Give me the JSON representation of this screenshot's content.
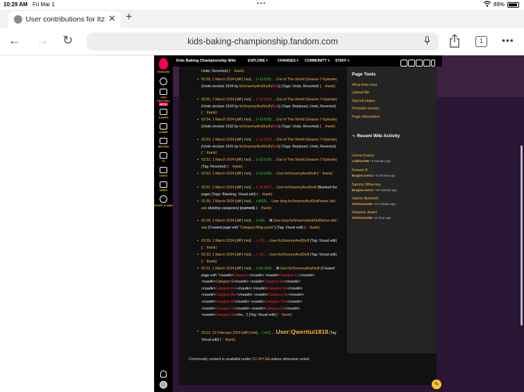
{
  "status_bar": {
    "time": "10:29 AM",
    "date": "Fri Mar 1",
    "battery": "89%"
  },
  "browser": {
    "tab_title": "User contributions for ItzSmarmyAndStuff",
    "url": "kids-baking-championship.fandom.com",
    "tab_count": "1"
  },
  "fandom_rail": {
    "logo_label": "FANDOM",
    "items": [
      {
        "label": "FAN CENTRAL",
        "badge": "BETA"
      },
      {
        "label": "GAMES"
      },
      {
        "label": "ANIME"
      },
      {
        "label": "MOVIES"
      },
      {
        "label": "TV"
      },
      {
        "label": "VIDEO"
      },
      {
        "label": "WIKIS"
      },
      {
        "label": "START A WIKI"
      }
    ]
  },
  "wiki_header": {
    "name": "Kids Baking Championship Wiki",
    "menus": [
      "EXPLORE",
      "CHANGES",
      "COMMUNITY",
      "STAFF"
    ]
  },
  "contributions": [
    {
      "lines": [
        [
          "Undo, Reverted) (",
          "w"
        ],
        [
          "♡",
          "heart"
        ],
        [
          " thank)",
          "y"
        ]
      ]
    },
    {
      "lines": [
        [
          "02:55, 1 March 2024",
          "y"
        ],
        [
          " (",
          "w"
        ],
        [
          "diff",
          "y"
        ],
        [
          " | ",
          "w"
        ],
        [
          "hist",
          "y"
        ],
        [
          ") . . ",
          "w"
        ],
        [
          "(+13,625)",
          "g"
        ],
        [
          " . . ",
          "w"
        ],
        [
          "Out of This World (Season 7 Episode)",
          "y"
        ],
        [
          " (Undo revision 3194 by ",
          "wi"
        ],
        [
          "ItzSmarmyAndStuff",
          "yi"
        ],
        [
          " (",
          "wi"
        ],
        [
          "talk",
          "ri"
        ],
        [
          ")) (Tags: Undo, Reverted) (",
          "w"
        ],
        [
          "♡",
          "heart"
        ],
        [
          " thank)",
          "y"
        ]
      ]
    },
    {
      "lines": [
        [
          "02:55, 1 March 2024",
          "y"
        ],
        [
          " (",
          "w"
        ],
        [
          "diff",
          "y"
        ],
        [
          " | ",
          "w"
        ],
        [
          "hist",
          "y"
        ],
        [
          ") . . ",
          "w"
        ],
        [
          "(−13,625)",
          "r"
        ],
        [
          " . . ",
          "w"
        ],
        [
          "Out of This World (Season 7 Episode)",
          "y"
        ],
        [
          " (Undo revision 3193 by ",
          "wi"
        ],
        [
          "ItzSmarmyAndStuff",
          "yi"
        ],
        [
          " (",
          "wi"
        ],
        [
          "talk",
          "ri"
        ],
        [
          ")) (Tags: Replaced, Undo, Reverted) (",
          "w"
        ],
        [
          "♡",
          "heart"
        ],
        [
          " thank)",
          "y"
        ]
      ]
    },
    {
      "lines": [
        [
          "02:54, 1 March 2024",
          "y"
        ],
        [
          " (",
          "w"
        ],
        [
          "diff",
          "y"
        ],
        [
          " | ",
          "w"
        ],
        [
          "hist",
          "y"
        ],
        [
          ") . . ",
          "w"
        ],
        [
          "(+13,625)",
          "g"
        ],
        [
          " . . ",
          "w"
        ],
        [
          "Out of This World (Season 7 Episode)",
          "y"
        ],
        [
          " (Undo revision 3192 by ",
          "wi"
        ],
        [
          "ItzSmarmyAndStuff",
          "yi"
        ],
        [
          " (",
          "wi"
        ],
        [
          "talk",
          "ri"
        ],
        [
          ")) (Tags: Undo, Reverted) (",
          "w"
        ],
        [
          "♡",
          "heart"
        ],
        [
          " thank)",
          "y"
        ]
      ]
    },
    {
      "lines": [
        [
          "02:53, 1 March 2024",
          "y"
        ],
        [
          " (",
          "w"
        ],
        [
          "diff",
          "y"
        ],
        [
          " | ",
          "w"
        ],
        [
          "hist",
          "y"
        ],
        [
          ") . . ",
          "w"
        ],
        [
          "(−13,625)",
          "r"
        ],
        [
          " . . ",
          "w"
        ],
        [
          "Out of This World (Season 7 Episode)",
          "y"
        ],
        [
          " (Undo revision 3191 by ",
          "wi"
        ],
        [
          "ItzSmarmyAndStuff",
          "yi"
        ],
        [
          " (",
          "wi"
        ],
        [
          "talk",
          "ri"
        ],
        [
          ")) (Tags: Replaced, Undo, Reverted) (",
          "w"
        ],
        [
          "♡",
          "heart"
        ],
        [
          " thank)",
          "y"
        ]
      ]
    },
    {
      "lines": [
        [
          "02:52, 1 March 2024",
          "y"
        ],
        [
          " (",
          "w"
        ],
        [
          "diff",
          "y"
        ],
        [
          " | ",
          "w"
        ],
        [
          "hist",
          "y"
        ],
        [
          ") . . ",
          "w"
        ],
        [
          "(+13,625)",
          "g"
        ],
        [
          " . . ",
          "w"
        ],
        [
          "Out of This World (Season 7 Episode)",
          "y"
        ],
        [
          " (Tag: Reverted) (",
          "w"
        ],
        [
          "♡",
          "heart"
        ],
        [
          " thank)",
          "y"
        ]
      ]
    },
    {
      "lines": [
        [
          "02:52, 1 March 2024",
          "y"
        ],
        [
          " (",
          "w"
        ],
        [
          "diff",
          "y"
        ],
        [
          " | ",
          "w"
        ],
        [
          "hist",
          "y"
        ],
        [
          ") . . ",
          "w"
        ],
        [
          "(+13,626)",
          "g"
        ],
        [
          " . . ",
          "w"
        ],
        [
          "User:ItzSmarmyAndStuff",
          "y"
        ],
        [
          " (",
          "w"
        ],
        [
          "♡",
          "heart"
        ],
        [
          " thank)",
          "y"
        ]
      ]
    },
    {
      "lines": [
        [
          "02:51, 1 March 2024",
          "y"
        ],
        [
          " (",
          "w"
        ],
        [
          "diff",
          "y"
        ],
        [
          " | ",
          "w"
        ],
        [
          "hist",
          "y"
        ],
        [
          ") . . ",
          "w"
        ],
        [
          "(−26,897)",
          "r"
        ],
        [
          " . . ",
          "w"
        ],
        [
          "User:ItzSmarmyAndStuff",
          "y"
        ],
        [
          " (Blanked the page) (Tags: Blanking, Visual edit) (",
          "w"
        ],
        [
          "♡",
          "heart"
        ],
        [
          " thank)",
          "y"
        ]
      ]
    },
    {
      "lines": [
        [
          "02:39, 1 March 2024",
          "y"
        ],
        [
          " (",
          "w"
        ],
        [
          "diff",
          "y"
        ],
        [
          " | ",
          "w"
        ],
        [
          "hist",
          "y"
        ],
        [
          ") . . ",
          "w"
        ],
        [
          "(+818)",
          "g"
        ],
        [
          " . . ",
          "w"
        ],
        [
          "User blog:ItzSmarmyAndStuff/when did i ask",
          "y"
        ],
        [
          " (Adding categories) ",
          "wi"
        ],
        [
          "(current)",
          "wb"
        ],
        [
          " (",
          "w"
        ],
        [
          "♡",
          "heart"
        ],
        [
          " thank)",
          "y"
        ]
      ]
    },
    {
      "lines": [
        [
          "02:39, 1 March 2024",
          "y"
        ],
        [
          " (",
          "w"
        ],
        [
          "diff",
          "y"
        ],
        [
          " | ",
          "w"
        ],
        [
          "hist",
          "y"
        ],
        [
          ") . . ",
          "w"
        ],
        [
          "(+24)",
          "g"
        ],
        [
          " . . ",
          "w"
        ],
        [
          "N ",
          "wb"
        ],
        [
          "User blog:ItzSmarmyAndStuff/when did i ask",
          "y"
        ],
        [
          " (Created page with \"",
          "wi"
        ],
        [
          "Category:Blog posts",
          "yi"
        ],
        [
          "\") (Tag: Visual edit) (",
          "w"
        ],
        [
          "♡",
          "heart"
        ],
        [
          " thank)",
          "y"
        ]
      ]
    },
    {
      "lines": [
        [
          "02:39, 1 March 2024",
          "y"
        ],
        [
          " (",
          "w"
        ],
        [
          "diff",
          "y"
        ],
        [
          " | ",
          "w"
        ],
        [
          "hist",
          "y"
        ],
        [
          ") . . ",
          "w"
        ],
        [
          "(−15)",
          "r"
        ],
        [
          " . . ",
          "w"
        ],
        [
          "User:ItzSmarmyAndStuff",
          "y"
        ],
        [
          " (Tag: Visual edit) (",
          "w"
        ],
        [
          "♡",
          "heart"
        ],
        [
          " thank)",
          "y"
        ]
      ]
    },
    {
      "lines": [
        [
          "02:32, 1 March 2024",
          "y"
        ],
        [
          " (",
          "w"
        ],
        [
          "diff",
          "y"
        ],
        [
          " | ",
          "w"
        ],
        [
          "hist",
          "y"
        ],
        [
          ") . . ",
          "w"
        ],
        [
          "(−12)",
          "r"
        ],
        [
          " . . ",
          "w"
        ],
        [
          "User:ItzSmarmyAndStuff",
          "y"
        ],
        [
          " (Tag: Visual edit) (",
          "w"
        ],
        [
          "♡",
          "heart"
        ],
        [
          " thank)",
          "y"
        ]
      ]
    },
    {
      "lines": [
        [
          "02:31, 1 March 2024",
          "y"
        ],
        [
          " (",
          "w"
        ],
        [
          "diff",
          "y"
        ],
        [
          " | ",
          "w"
        ],
        [
          "hist",
          "y"
        ],
        [
          ") . . ",
          "w"
        ],
        [
          "(+26,924)",
          "g"
        ],
        [
          " . . ",
          "w"
        ],
        [
          "N ",
          "wb"
        ],
        [
          "User:ItzSmarmyAndStuff",
          "y"
        ],
        [
          " (Created page with \"<nowiki>",
          "wi"
        ],
        [
          "Category:",
          "ri"
        ],
        [
          "</nowiki> <nowiki>",
          "wi"
        ],
        [
          "Category:Ca",
          "ri"
        ],
        [
          "</nowiki> <nowiki>",
          "wi"
        ],
        [
          "Category:S",
          "yi"
        ],
        [
          "</nowiki> <nowiki>",
          "wi"
        ],
        [
          "Category:Ste",
          "ri"
        ],
        [
          "</nowiki> <nowiki>",
          "wi"
        ],
        [
          "Category:Fre",
          "ri"
        ],
        [
          "</nowiki> <nowiki>",
          "wi"
        ],
        [
          "Category:Ge",
          "ri"
        ],
        [
          "</nowiki> <nowiki>",
          "wi"
        ],
        [
          "Category:Ben",
          "ri"
        ],
        [
          "</nowiki> <nowiki>",
          "wi"
        ],
        [
          "Category:Sei",
          "ri"
        ],
        [
          "</nowiki> <nowiki>",
          "wi"
        ],
        [
          "Category:Ei",
          "ri"
        ],
        [
          "</nowiki> <nowiki>",
          "wi"
        ],
        [
          "Category:Twe",
          "ri"
        ],
        [
          "</nowiki> <nowiki>",
          "wi"
        ],
        [
          "Category:Gi",
          "ri"
        ],
        [
          "</nowiki> <nowiki>",
          "wi"
        ],
        [
          "Category:Eli",
          "ri"
        ],
        [
          "</nowiki> <nowiki>",
          "wi"
        ],
        [
          "Category:Se",
          "ri"
        ],
        [
          "</no...\") [Tag: Visual edit] (",
          "w"
        ],
        [
          "♡",
          "heart"
        ],
        [
          " thank)",
          "y"
        ]
      ]
    },
    {
      "lines": [
        [
          "20:10, 12 February 2024",
          "y"
        ],
        [
          " (",
          "w"
        ],
        [
          "diff",
          "y"
        ],
        [
          " | ",
          "w"
        ],
        [
          "hist",
          "y"
        ],
        [
          ") . . ",
          "w"
        ],
        [
          "(+62)",
          "g"
        ],
        [
          " . . ",
          "w"
        ],
        [
          "User:Qwerttui1818",
          "big"
        ],
        [
          " (Tag: Visual edit) (",
          "w"
        ],
        [
          "♡",
          "heart"
        ],
        [
          " thank)",
          "y"
        ]
      ]
    }
  ],
  "footer": {
    "text_before": "Community content is available under ",
    "license": "CC-BY-SA",
    "text_after": " unless otherwise noted."
  },
  "page_tools": {
    "title": "Page Tools",
    "links": [
      "What links here",
      "Upload file",
      "Special pages",
      "Printable version",
      "Page information"
    ]
  },
  "recent_activity": {
    "title": "Recent Wiki Activity",
    "items": [
      {
        "page": "Llama Drama",
        "user": "Lolitlover56",
        "time": "5 minutes ago"
      },
      {
        "page": "Season 8",
        "user": "BurgerLover11",
        "time": "8 minutes ago"
      },
      {
        "page": "Sammy Whammy",
        "user": "BurgerLover11",
        "time": "25 minutes ago"
      },
      {
        "page": "Valerie Bertinelli",
        "user": "Toinloucie159",
        "time": "44 minutes ago"
      },
      {
        "page": "Natasha Jiwani",
        "user": "Toinloucie159",
        "time": "an hour ago"
      }
    ]
  },
  "colors": {
    "accent": "#f7b436",
    "add": "#2fd32f",
    "remove": "#ff2a2a",
    "background": "#111111",
    "rail": "#242424"
  }
}
